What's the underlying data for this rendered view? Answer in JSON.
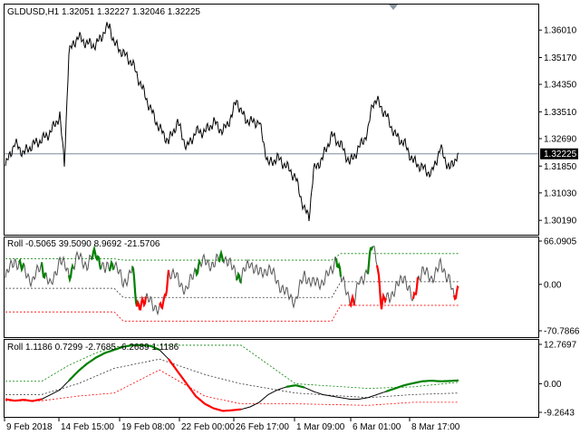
{
  "chart_data": [
    {
      "type": "line",
      "title": "GLDUSD,H1  1.32051 1.32227 1.32046 1.32225",
      "ylim": [
        1.3,
        1.3632
      ],
      "yticks": [
        1.3601,
        1.3517,
        1.3435,
        1.3351,
        1.3269,
        1.3185,
        1.3103,
        1.3019
      ],
      "ytick_labels": [
        "1.36010",
        "1.35170",
        "1.34350",
        "1.33510",
        "1.32690",
        "1.31850",
        "1.31030",
        "1.30190"
      ],
      "current_price": 1.32225,
      "current_price_label": "1.32225",
      "x": [
        0,
        10,
        20,
        30,
        40,
        50,
        60,
        65,
        70,
        75,
        80,
        90,
        100,
        110,
        115,
        120,
        130,
        140,
        150,
        160,
        170,
        180,
        190,
        200,
        210,
        220,
        230,
        240,
        250,
        255,
        260,
        265,
        270,
        280,
        290,
        300,
        310,
        320,
        330,
        335,
        340,
        350,
        360,
        370,
        380,
        390,
        400,
        405,
        410,
        420,
        430,
        440,
        450,
        460,
        470,
        480,
        490,
        500
      ],
      "values": [
        1.3185,
        1.3255,
        1.3225,
        1.325,
        1.3265,
        1.329,
        1.334,
        1.319,
        1.353,
        1.356,
        1.358,
        1.356,
        1.3555,
        1.36,
        1.3615,
        1.356,
        1.353,
        1.35,
        1.343,
        1.336,
        1.33,
        1.326,
        1.332,
        1.324,
        1.329,
        1.329,
        1.332,
        1.329,
        1.334,
        1.339,
        1.335,
        1.333,
        1.332,
        1.332,
        1.319,
        1.321,
        1.3185,
        1.315,
        1.305,
        1.303,
        1.317,
        1.321,
        1.328,
        1.325,
        1.3195,
        1.324,
        1.329,
        1.338,
        1.3385,
        1.334,
        1.328,
        1.3255,
        1.32,
        1.318,
        1.316,
        1.324,
        1.3175,
        1.3225
      ]
    },
    {
      "type": "line",
      "title": "Roll -0.5065 39.5090 8.9692 -21.5706",
      "ylim": [
        -70.7866,
        66.0905
      ],
      "ytick_labels": [
        "66.0905",
        "0.00",
        "-70.7866"
      ],
      "yticks": [
        66.0905,
        0,
        -70.7866
      ],
      "bands": {
        "upper": [
          [
            0,
            39
          ],
          [
            120,
            39
          ],
          [
            130,
            37
          ],
          [
            360,
            37
          ],
          [
            370,
            47
          ],
          [
            500,
            47
          ]
        ],
        "middle": [
          [
            0,
            -6
          ],
          [
            120,
            -6
          ],
          [
            130,
            -20
          ],
          [
            360,
            -20
          ],
          [
            370,
            4
          ],
          [
            500,
            4
          ]
        ],
        "lower": [
          [
            0,
            -42
          ],
          [
            120,
            -42
          ],
          [
            130,
            -56
          ],
          [
            360,
            -56
          ],
          [
            370,
            -32
          ],
          [
            500,
            -32
          ]
        ]
      },
      "x": [
        0,
        10,
        20,
        30,
        40,
        50,
        60,
        70,
        80,
        90,
        100,
        110,
        120,
        130,
        140,
        145,
        150,
        160,
        170,
        175,
        180,
        190,
        200,
        210,
        220,
        230,
        240,
        250,
        260,
        270,
        280,
        290,
        300,
        310,
        320,
        330,
        340,
        350,
        360,
        365,
        370,
        380,
        385,
        390,
        400,
        405,
        410,
        415,
        420,
        430,
        440,
        450,
        455,
        460,
        470,
        480,
        490,
        495,
        500
      ],
      "values": [
        10,
        38,
        22,
        5,
        30,
        -5,
        40,
        15,
        42,
        30,
        48,
        20,
        35,
        0,
        25,
        -35,
        -25,
        -25,
        -40,
        -30,
        20,
        8,
        -10,
        25,
        35,
        30,
        45,
        25,
        10,
        35,
        15,
        25,
        5,
        -15,
        -25,
        15,
        0,
        5,
        20,
        45,
        10,
        -20,
        -30,
        5,
        20,
        62,
        40,
        -35,
        -20,
        -10,
        15,
        -30,
        10,
        20,
        10,
        28,
        10,
        -25,
        -5
      ],
      "highlight": [
        {
          "color": "#008000",
          "ranges": [
            [
              15,
              20
            ],
            [
              40,
              45
            ],
            [
              70,
              75
            ],
            [
              95,
              105
            ],
            [
              115,
              120
            ],
            [
              140,
              145
            ],
            [
              210,
              215
            ],
            [
              235,
              240
            ],
            [
              255,
              260
            ],
            [
              365,
              370
            ],
            [
              400,
              405
            ]
          ]
        },
        {
          "color": "#ff0000",
          "ranges": [
            [
              145,
              155
            ],
            [
              170,
              180
            ],
            [
              380,
              385
            ],
            [
              410,
              420
            ],
            [
              450,
              455
            ],
            [
              495,
              500
            ]
          ]
        }
      ]
    },
    {
      "type": "line",
      "title": "Roll 1.1186 0.7299 -2.7685 -6.2689 1.1186",
      "ylim": [
        -9.2643,
        12.7697
      ],
      "ytick_labels": [
        "12.7697",
        "0.00",
        "-9.2643"
      ],
      "yticks": [
        12.7697,
        0,
        -9.2643
      ],
      "bands": {
        "upper": [
          [
            0,
            0.8
          ],
          [
            40,
            0.8
          ],
          [
            70,
            6
          ],
          [
            100,
            10
          ],
          [
            120,
            12
          ],
          [
            170,
            12.5
          ],
          [
            260,
            12.5
          ],
          [
            320,
            0
          ],
          [
            400,
            -1.5
          ],
          [
            450,
            -1
          ],
          [
            500,
            0.5
          ]
        ],
        "middle": [
          [
            0,
            -3.5
          ],
          [
            40,
            -3.5
          ],
          [
            80,
            0
          ],
          [
            120,
            5
          ],
          [
            170,
            8
          ],
          [
            220,
            3
          ],
          [
            260,
            0
          ],
          [
            320,
            -3
          ],
          [
            400,
            -4.5
          ],
          [
            450,
            -3.5
          ],
          [
            500,
            -3
          ]
        ],
        "lower": [
          [
            0,
            -5.5
          ],
          [
            40,
            -5.5
          ],
          [
            80,
            -4
          ],
          [
            120,
            -3
          ],
          [
            170,
            4.5
          ],
          [
            220,
            -4
          ],
          [
            260,
            -6.5
          ],
          [
            320,
            -6.5
          ],
          [
            400,
            -7
          ],
          [
            450,
            -6
          ],
          [
            500,
            -6
          ]
        ]
      },
      "x": [
        0,
        10,
        20,
        30,
        40,
        50,
        60,
        70,
        80,
        90,
        100,
        110,
        120,
        130,
        140,
        150,
        160,
        170,
        180,
        190,
        200,
        210,
        220,
        230,
        240,
        250,
        260,
        270,
        280,
        290,
        300,
        310,
        320,
        330,
        340,
        350,
        360,
        370,
        380,
        390,
        400,
        410,
        420,
        430,
        440,
        450,
        460,
        470,
        480,
        490,
        500
      ],
      "values": [
        -5.0,
        -5.5,
        -5.2,
        -5.6,
        -5.0,
        -3.5,
        -2.0,
        1.0,
        4.0,
        6.5,
        8.5,
        10.0,
        11.0,
        12.0,
        12.5,
        12.5,
        12.3,
        11.0,
        8.0,
        4.0,
        0,
        -4.0,
        -6.5,
        -8.0,
        -8.8,
        -8.6,
        -8.3,
        -7.5,
        -6.0,
        -3.5,
        -2.0,
        -1.0,
        -0.5,
        -1.2,
        -2.5,
        -3.5,
        -4.0,
        -4.5,
        -5.0,
        -5.0,
        -4.5,
        -3.5,
        -2.5,
        -1.5,
        -0.5,
        0.2,
        0.8,
        1.0,
        0.8,
        0.9,
        1.1
      ],
      "highlight": [
        {
          "color": "#008000",
          "ranges": [
            [
              70,
              170
            ],
            [
              310,
              330
            ],
            [
              420,
              500
            ]
          ]
        },
        {
          "color": "#ff0000",
          "ranges": [
            [
              0,
              40
            ],
            [
              180,
              260
            ]
          ]
        }
      ]
    }
  ],
  "x_axis": {
    "labels": [
      "9 Feb 2018",
      "14 Feb 15:00",
      "19 Feb 08:00",
      "22 Feb 00:00",
      "26 Feb 17:00",
      "1 Mar 09:00",
      "6 Mar 01:00",
      "8 Mar 17:00"
    ],
    "label_x": [
      5,
      65,
      132,
      198,
      258,
      325,
      387,
      452
    ]
  }
}
